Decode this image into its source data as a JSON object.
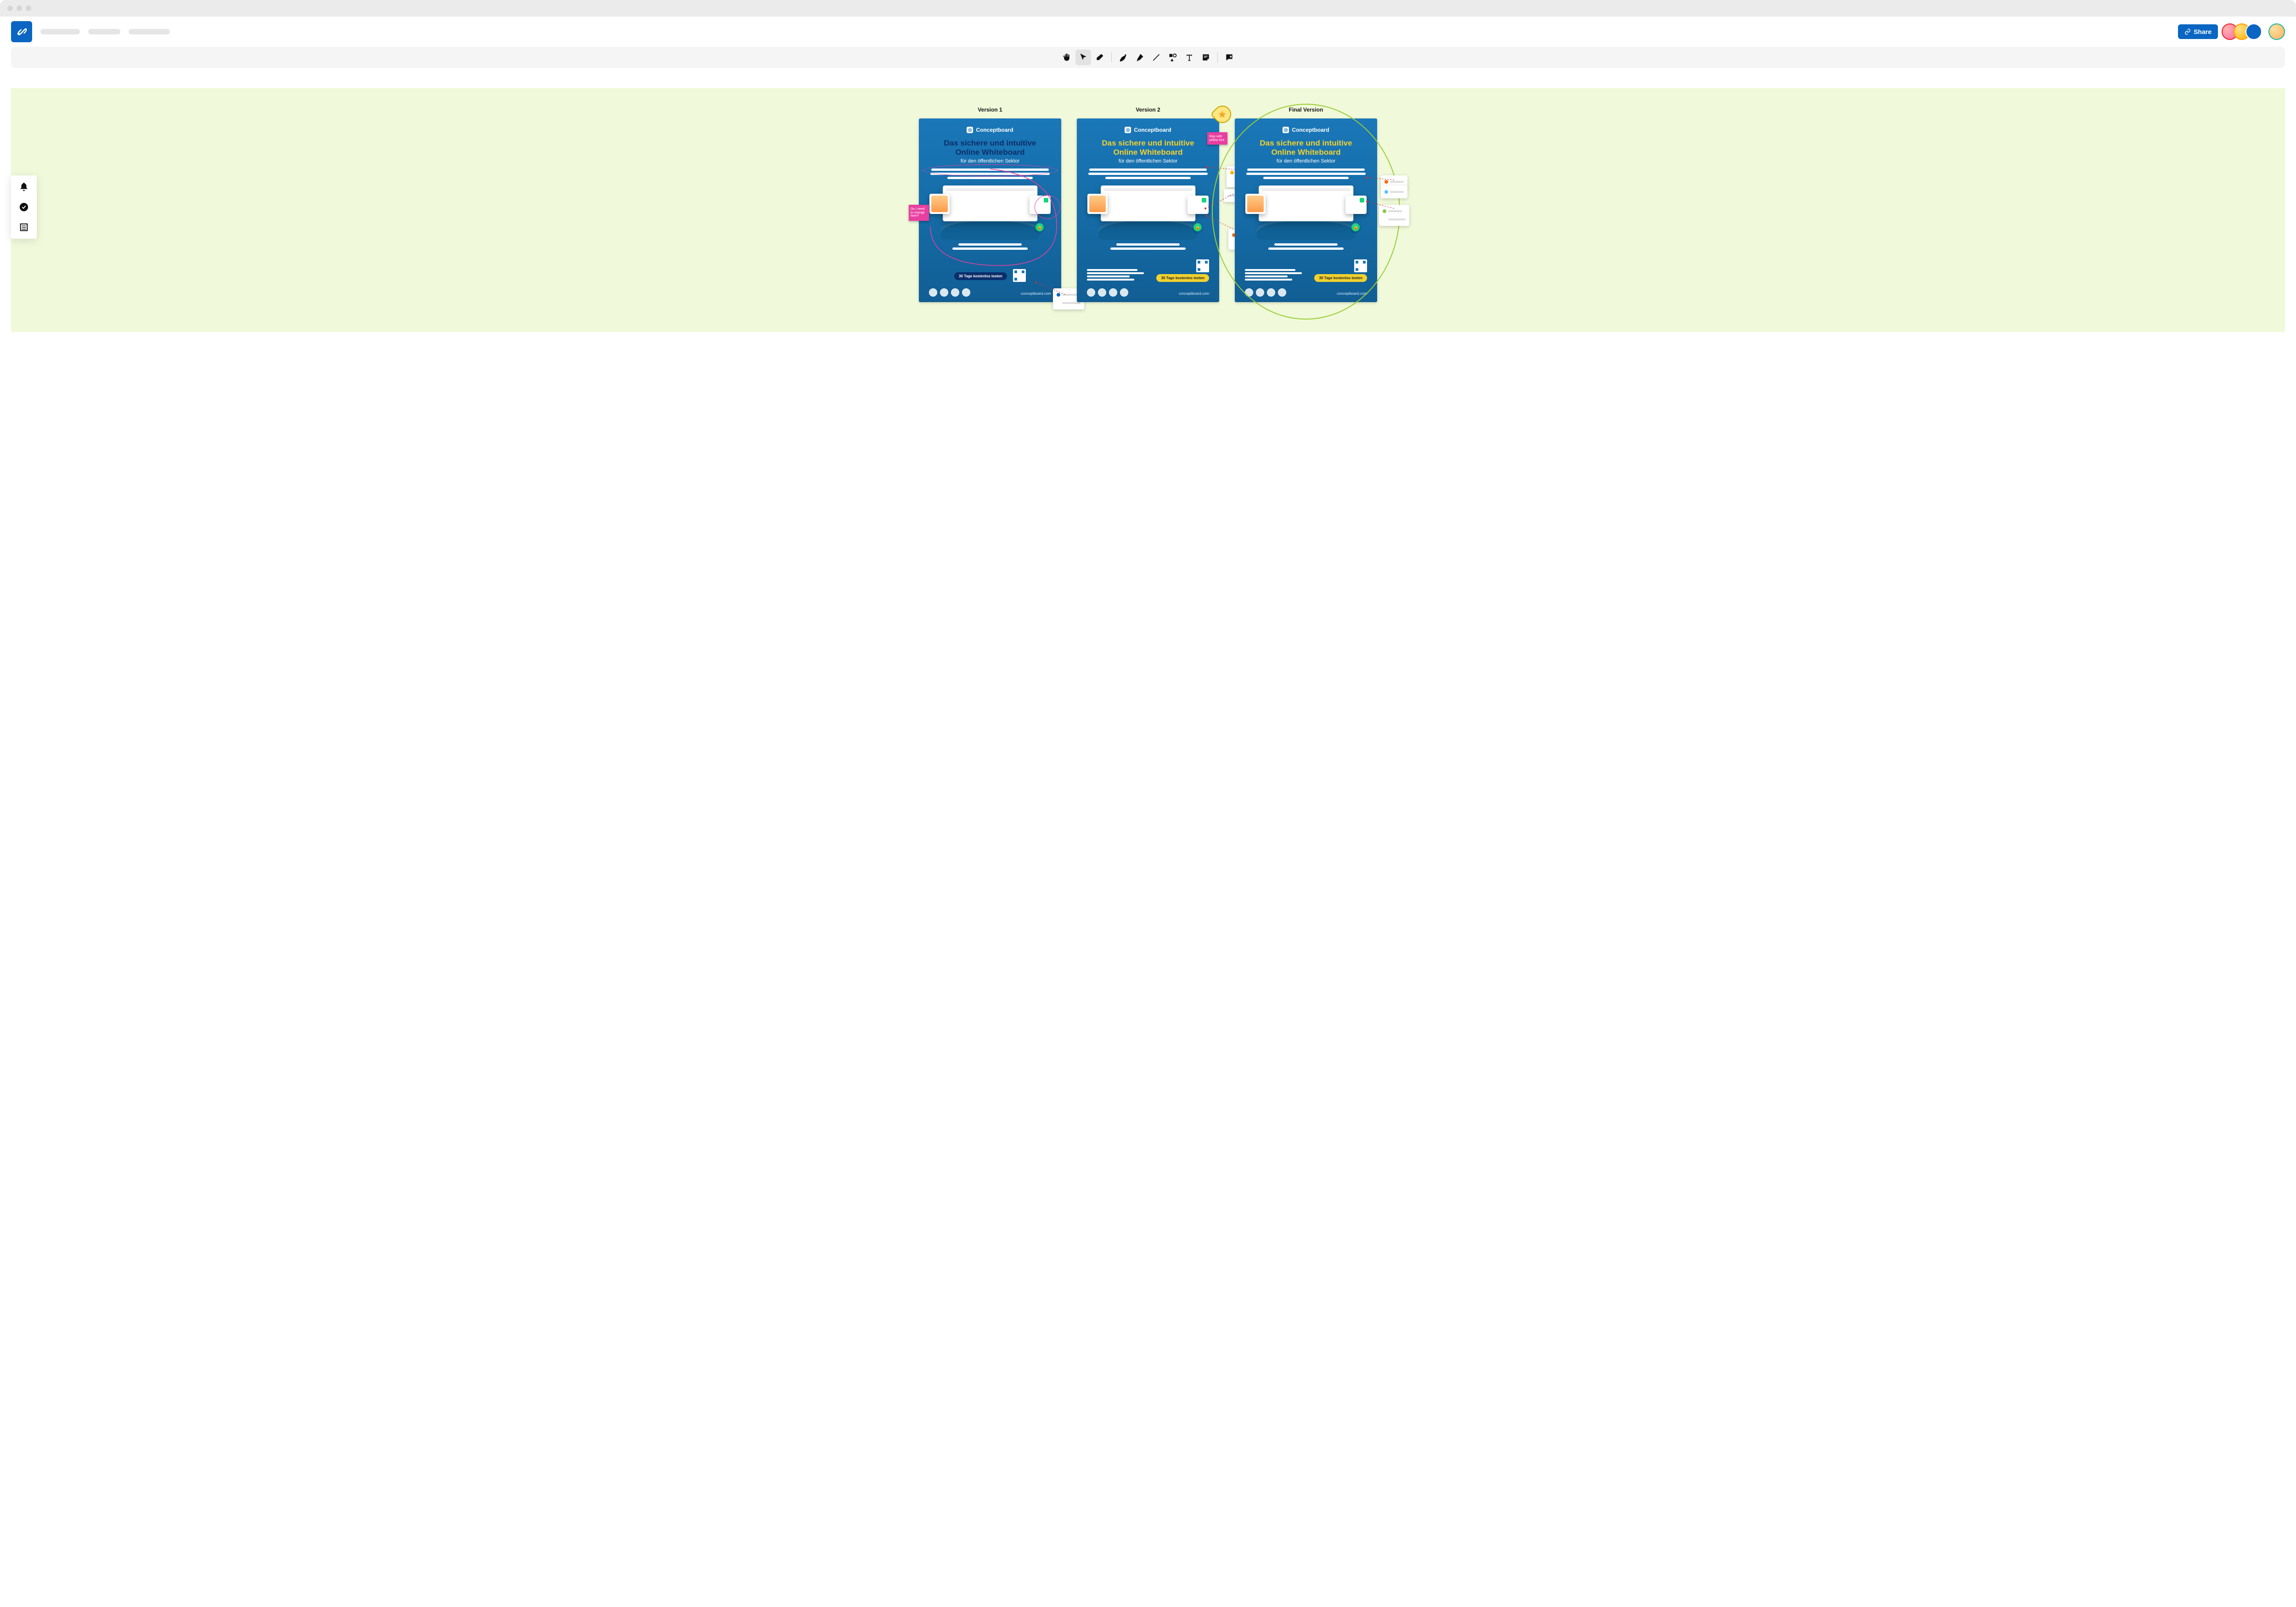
{
  "header": {
    "share_label": "Share"
  },
  "board": {
    "versions": [
      {
        "label": "Version 1",
        "headline_variant": "navy",
        "cta_variant": "navy"
      },
      {
        "label": "Version 2",
        "headline_variant": "gold",
        "cta_variant": "gold"
      },
      {
        "label": "Final Version",
        "headline_variant": "gold",
        "cta_variant": "gold"
      }
    ]
  },
  "poster": {
    "brand": "Conceptboard",
    "headline_line1": "Das sichere und intuitive",
    "headline_line2": "Online Whiteboard",
    "subhead": "für den öffentlichen Sektor",
    "cta_label": "30 Tage kostenlos testen",
    "footer_url": "conceptboard.com"
  },
  "sticky_notes": {
    "v1_left": "Do I need to change here?",
    "v2_right": "Stay with yellow font"
  }
}
